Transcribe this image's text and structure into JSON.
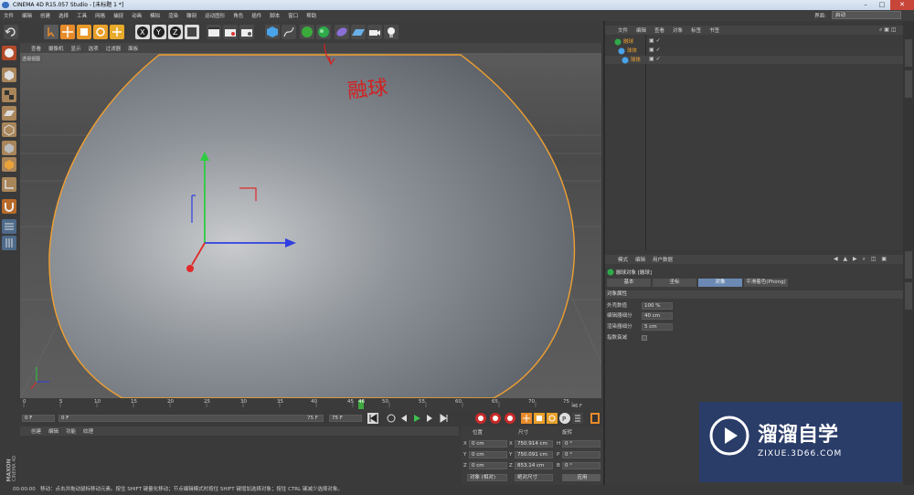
{
  "window": {
    "title": "CINEMA 4D R15.057 Studio - [未标题 1 *]"
  },
  "menubar": {
    "items": [
      "文件",
      "编辑",
      "创建",
      "选择",
      "工具",
      "网格",
      "捕捉",
      "动画",
      "模拟",
      "渲染",
      "雕刻",
      "运动图形",
      "角色",
      "插件",
      "脚本",
      "窗口",
      "帮助"
    ]
  },
  "layout": {
    "label": "界面:",
    "value": "启动"
  },
  "viewport": {
    "menu": [
      "查看",
      "摄像机",
      "显示",
      "选项",
      "过滤器",
      "面板"
    ],
    "label": "透视视图"
  },
  "timeline": {
    "ticks": [
      "0",
      "5",
      "10",
      "15",
      "20",
      "25",
      "30",
      "35",
      "40",
      "45",
      "50",
      "55",
      "60",
      "65",
      "70",
      "75"
    ],
    "current_frame": "46",
    "end_frame": "46 F"
  },
  "playbar": {
    "start": "0 F",
    "min": "0 F",
    "max": "75 F",
    "end": "75 F"
  },
  "material_manager": {
    "menu": [
      "创建",
      "编辑",
      "功能",
      "纹理"
    ]
  },
  "coordinates": {
    "headers": [
      "位置",
      "尺寸",
      "旋转"
    ],
    "rows": [
      {
        "axis": "X",
        "pos": "0 cm",
        "size": "750.914 cm",
        "rot_axis": "H",
        "rot": "0 °"
      },
      {
        "axis": "Y",
        "pos": "0 cm",
        "size": "750.091 cm",
        "rot_axis": "P",
        "rot": "0 °"
      },
      {
        "axis": "Z",
        "pos": "0 cm",
        "size": "853.14 cm",
        "rot_axis": "B",
        "rot": "0 °"
      }
    ],
    "mode_select": "对象 (相对)",
    "size_select": "绝对尺寸",
    "apply_label": "应用"
  },
  "object_manager": {
    "menu": [
      "文件",
      "编辑",
      "查看",
      "对象",
      "标签",
      "书签"
    ],
    "items": [
      {
        "name": "融球"
      },
      {
        "name": "球体"
      },
      {
        "name": "球体"
      }
    ]
  },
  "attributes": {
    "menu": [
      "模式",
      "编辑",
      "用户数据"
    ],
    "title": "融球对象 [融球]",
    "tabs": [
      "基本",
      "坐标",
      "对象",
      "平滑着色(Phong)"
    ],
    "active_tab": "对象",
    "section": "对象属性",
    "fields": [
      {
        "label": "外壳数值",
        "value": "100 %"
      },
      {
        "label": "编辑器细分",
        "value": "40 cm"
      },
      {
        "label": "渲染器细分",
        "value": "5 cm"
      },
      {
        "label": "指数衰减",
        "value": ""
      }
    ]
  },
  "annotation": {
    "text": "融球"
  },
  "status": {
    "time": "00:00:00",
    "message": "移动：点击并拖动鼠标移动元素。按住 SHIFT 键量化移动；节点编辑模式时按住 SHIFT 键增加选择对象；按住 CTRL 键减少选择对象。"
  },
  "watermark": {
    "title": "溜溜自学",
    "url": "ZIXUE.3D66.COM"
  },
  "maxon": {
    "brand": "MAXON",
    "product": "CINEMA 4D"
  },
  "colors": {
    "accent": "#6b89b3",
    "selection_orange": "#e8a33a",
    "annotation_red": "#d42020"
  }
}
